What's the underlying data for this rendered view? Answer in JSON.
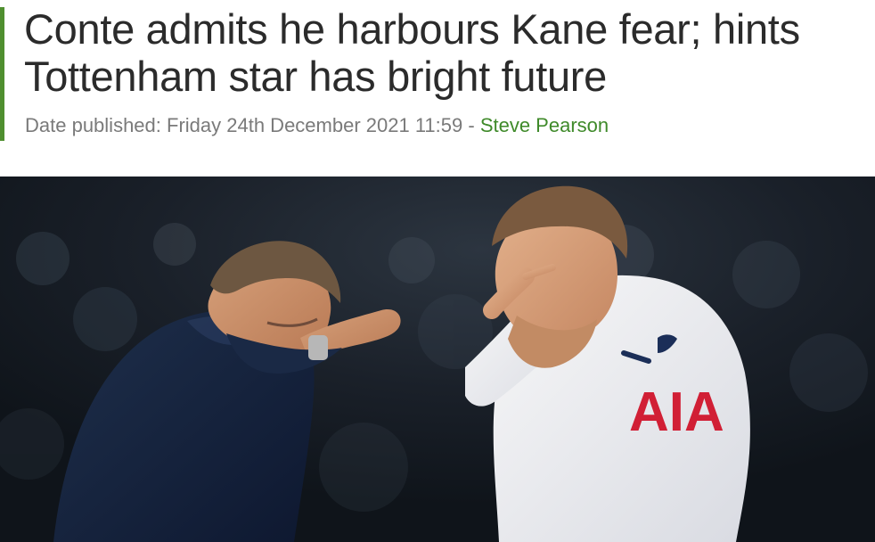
{
  "article": {
    "headline": "Conte admits he harbours Kane fear; hints Tottenham star has bright future",
    "meta": {
      "date_prefix": "Date published:",
      "date": "Friday 24th December 2021 11:59",
      "separator": " - ",
      "author": "Steve Pearson"
    },
    "image": {
      "sponsor_text": "AIA"
    }
  },
  "colors": {
    "accent": "#4f8f2f",
    "headline": "#2b2b2b",
    "meta": "#7a7a7a",
    "author": "#3f8a2a"
  }
}
